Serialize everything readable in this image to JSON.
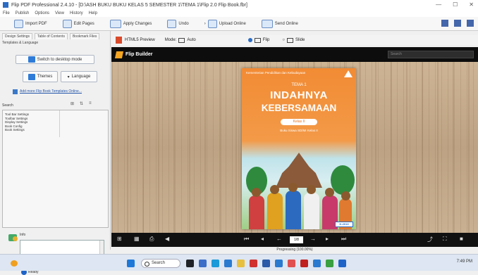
{
  "window": {
    "title": "Flip PDF Professional 2.4.10 - [D:\\ASH BUKU BUKU KELAS 5 SEMESTER 1\\TEMA 1\\Flip 2.0 Flip Book.fbr]",
    "controls": [
      "—",
      "☐",
      "✕"
    ]
  },
  "menu": [
    "File",
    "Publish",
    "Options",
    "View",
    "History",
    "Help"
  ],
  "toolbar": {
    "items": [
      "Import PDF",
      "Edit Pages",
      "Apply Changes",
      "Undo",
      "Redo",
      "Upload Online",
      "Send Online"
    ]
  },
  "left_panel": {
    "tabs": [
      "Design Settings",
      "Table of Contents",
      "Bookmark Files"
    ],
    "subtab": "Templates & Language",
    "switch_button": "Switch to desktop mode",
    "themes_button": "Themes",
    "language_button": "Language",
    "link_text": "Add more Flip Book Templates Online...",
    "search_label": "Search",
    "settings_items": [
      "Tool Bar Settings",
      "Toolbar Settings",
      "Display Settings",
      "Book Config",
      "Book Settings"
    ],
    "description_label": "Info",
    "status_label": "Ready"
  },
  "preview_bar": {
    "label": "HTML5 Preview",
    "mode_label": "Mode:",
    "mode_value": "Auto",
    "flip_label": "Flip",
    "slide_label": "Slide"
  },
  "flip": {
    "brand": "Flip Builder",
    "search_placeholder": "Search"
  },
  "book": {
    "publisher": "Kementerian Pendidikan dan Kebudayaan",
    "tema": "TEMA 1",
    "title_line1": "INDAHNYA",
    "title_line2": "KEBERSAMAAN",
    "kelas": "Kelas II",
    "subtitle": "Buku Siswa SD/MI Kelas II",
    "badge": "K-2013"
  },
  "playbar": {
    "page_value": "1/8"
  },
  "status": {
    "text": "Progressing (100.00%)"
  },
  "taskbar": {
    "search_label": "Search",
    "time": "7:49 PM"
  }
}
